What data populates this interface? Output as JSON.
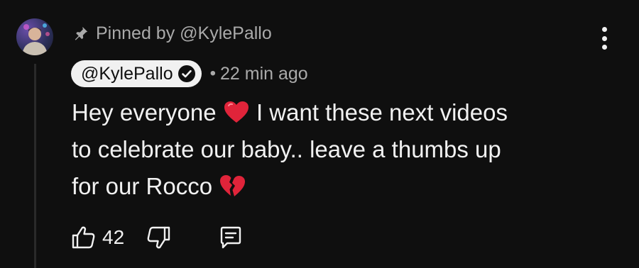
{
  "pinned": {
    "icon": "pin-icon",
    "text": "Pinned by @KylePallo"
  },
  "author": {
    "handle": "@KylePallo",
    "verified_icon": "verified-check-icon",
    "chip_color": "#f1f1f1"
  },
  "separator": "•",
  "timestamp": "22 min ago",
  "comment": {
    "segments": [
      {
        "type": "text",
        "value": "Hey everyone "
      },
      {
        "type": "emoji",
        "value": "red-heart-emoji"
      },
      {
        "type": "text",
        "value": " I want these next videos"
      },
      {
        "type": "br"
      },
      {
        "type": "text",
        "value": "to celebrate our baby.. leave a thumbs up"
      },
      {
        "type": "br"
      },
      {
        "type": "text",
        "value": "for our Rocco "
      },
      {
        "type": "emoji",
        "value": "broken-heart-emoji"
      }
    ]
  },
  "actions": {
    "like_icon": "thumbs-up-icon",
    "like_count": "42",
    "dislike_icon": "thumbs-down-icon",
    "reply_icon": "reply-comment-icon"
  },
  "colors": {
    "background": "#0f0f0f",
    "primary_text": "#f1f1f1",
    "secondary_text": "#aaaaaa",
    "heart": "#e0243a"
  }
}
